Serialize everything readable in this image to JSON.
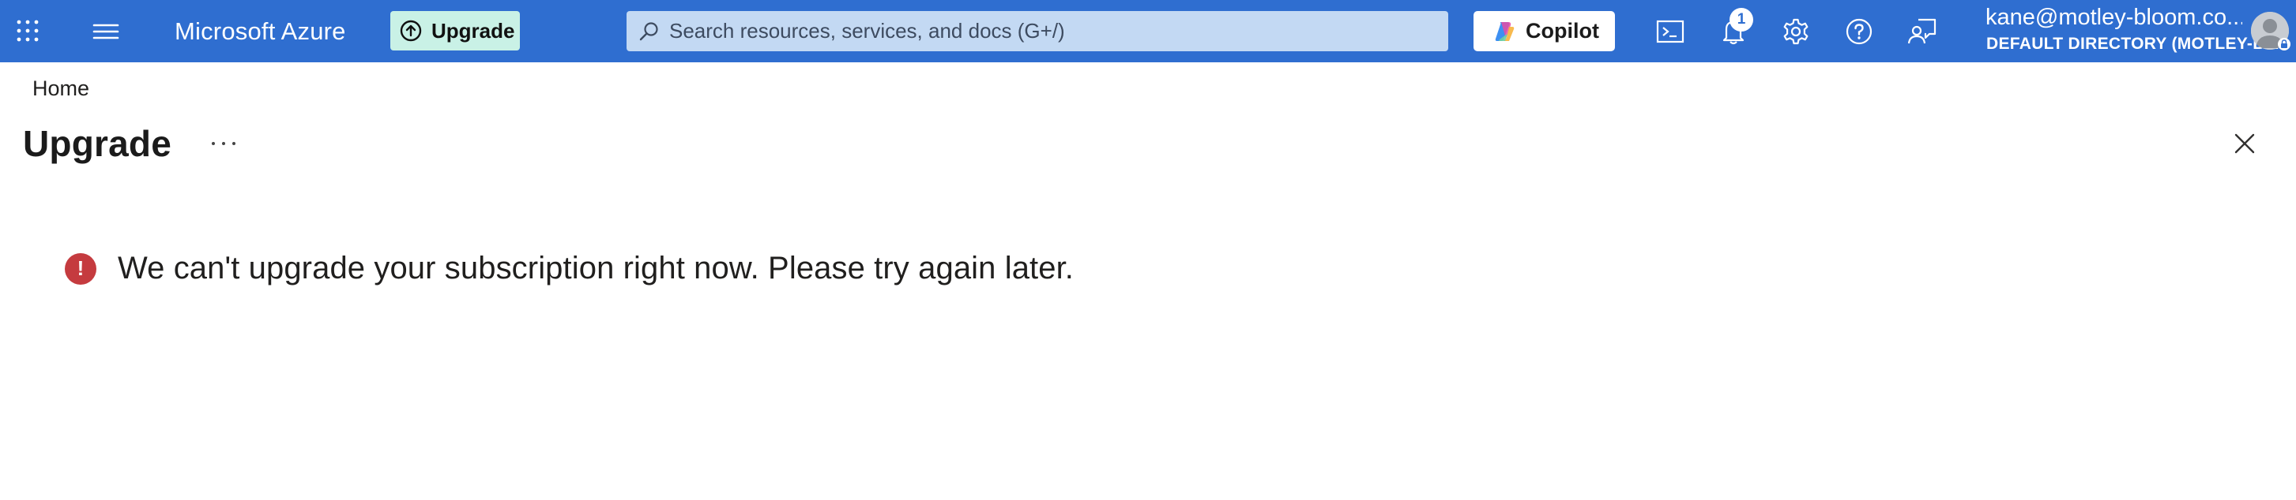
{
  "topbar": {
    "brand": "Microsoft Azure",
    "upgrade_label": "Upgrade",
    "search_placeholder": "Search resources, services, and docs (G+/)",
    "copilot_label": "Copilot",
    "notification_count": "1",
    "account_name": "kane@motley-bloom.co...",
    "account_directory": "DEFAULT DIRECTORY (MOTLEY-B..."
  },
  "breadcrumb": {
    "home": "Home"
  },
  "page": {
    "title": "Upgrade",
    "error_message": "We can't upgrade your subscription right now. Please try again later."
  },
  "colors": {
    "topbar": "#2f6ed0",
    "upgrade_button": "#c9f1e6",
    "search_box": "#c3d9f3",
    "error": "#c53b3f"
  }
}
